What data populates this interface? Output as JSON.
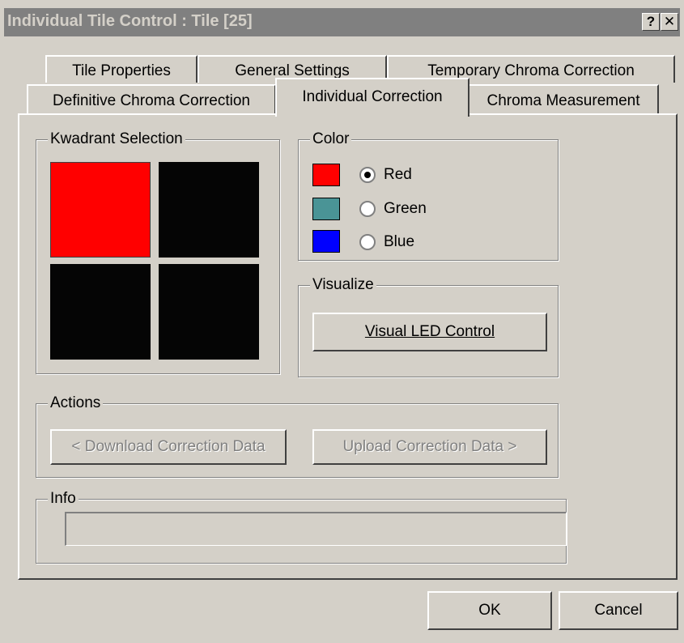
{
  "window": {
    "title": "Individual Tile Control : Tile [25]",
    "help_label": "?",
    "close_label": "✕"
  },
  "tabs": {
    "row1": [
      "Tile Properties",
      "General Settings",
      "Temporary Chroma Correction"
    ],
    "row2": [
      "Definitive Chroma Correction",
      "Individual Correction",
      "Chroma Measurement"
    ],
    "active": "Individual Correction"
  },
  "kwadrant": {
    "label": "Kwadrant Selection",
    "quadrants": [
      "top-left",
      "top-right",
      "bottom-left",
      "bottom-right"
    ],
    "selected": "top-left",
    "selected_color": "#ff0000",
    "unselected_color": "#050505"
  },
  "color": {
    "label": "Color",
    "options": [
      {
        "label": "Red",
        "swatch": "#ff0000",
        "checked": true
      },
      {
        "label": "Green",
        "swatch": "#4a9496",
        "checked": false
      },
      {
        "label": "Blue",
        "swatch": "#0000ff",
        "checked": false
      }
    ]
  },
  "visualize": {
    "label": "Visualize",
    "button": "Visual LED Control"
  },
  "actions": {
    "label": "Actions",
    "download": "< Download Correction Data",
    "upload": "Upload Correction Data >",
    "enabled": false
  },
  "info": {
    "label": "Info",
    "value": ""
  },
  "footer": {
    "ok": "OK",
    "cancel": "Cancel"
  }
}
